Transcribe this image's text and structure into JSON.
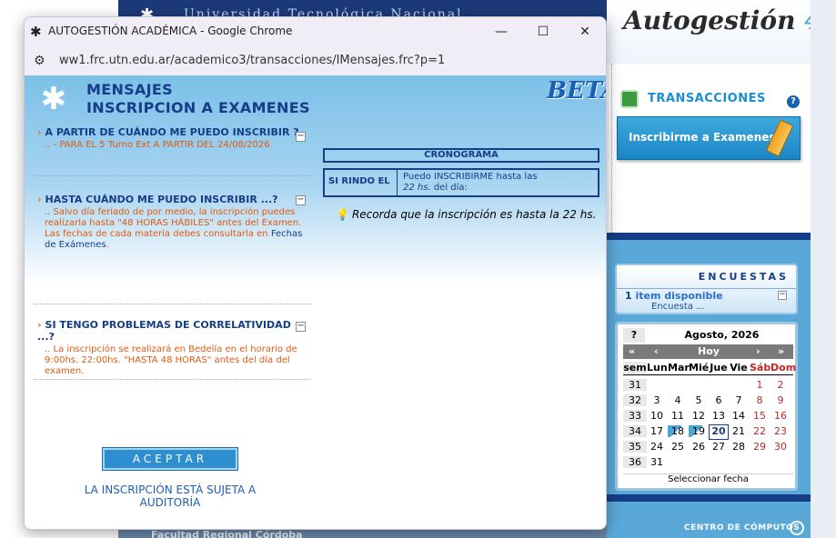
{
  "background": {
    "university_title": "Universidad Tecnológica Nacional",
    "brand": {
      "name": "Autogestión",
      "version": "4"
    },
    "transacciones": {
      "title": "TRANSACCIONES",
      "help": "?",
      "inscribir_button": "Inscribirme a Examenes"
    },
    "encuestas": {
      "title": "ENCUESTAS",
      "count": "1",
      "available_label": "item disponible",
      "item": "Encuesta ..."
    },
    "calendar": {
      "help": "?",
      "month_label": "Agosto, 2026",
      "nav": {
        "prev_year": "«",
        "prev_month": "‹",
        "today": "Hoy",
        "next_month": "›",
        "next_year": "»"
      },
      "dow": [
        "sem",
        "Lun",
        "Mar",
        "Mié",
        "Jue",
        "Vie",
        "Sáb",
        "Dom"
      ],
      "weeks": [
        {
          "wk": "31",
          "days": [
            "",
            "",
            "",
            "",
            "",
            "1",
            "2"
          ]
        },
        {
          "wk": "32",
          "days": [
            "3",
            "4",
            "5",
            "6",
            "7",
            "8",
            "9"
          ]
        },
        {
          "wk": "33",
          "days": [
            "10",
            "11",
            "12",
            "13",
            "14",
            "15",
            "16"
          ]
        },
        {
          "wk": "34",
          "days": [
            "17",
            "18",
            "19",
            "20",
            "21",
            "22",
            "23"
          ]
        },
        {
          "wk": "35",
          "days": [
            "24",
            "25",
            "26",
            "27",
            "28",
            "29",
            "30"
          ]
        },
        {
          "wk": "36",
          "days": [
            "31",
            "",
            "",
            "",
            "",
            "",
            ""
          ]
        }
      ],
      "today": "20",
      "footer": "Seleccionar fecha"
    },
    "footer_left": "Facultad Regional Córdoba",
    "footer_right": "CENTRO DE CÓMPUTOS"
  },
  "window": {
    "title": "AUTOGESTIÓN ACADÉMICA - Google Chrome",
    "url": "ww1.frc.utn.edu.ar/academico3/transacciones/IMensajes.frc?p=1",
    "controls": {
      "minimize": "—",
      "maximize": "☐",
      "close": "✕"
    }
  },
  "page": {
    "heading_line1": "MENSAJES",
    "heading_line2": "INSCRIPCION A EXAMENES",
    "beta": "BETA",
    "sections": [
      {
        "title": "A PARTIR DE CUÁNDO ME PUEDO INSCRIBIR ?",
        "body": ".. - PARA EL 5 Turno Ext A PARTIR DEL 24/08/2026",
        "toggle": "−"
      },
      {
        "title": "HASTA CUÁNDO ME PUEDO INSCRIBIR ...?",
        "body": ".. Salvo día feriado de por medio, la inscripción puedes realizarla hasta \"48 HORAS HÁBILES\" antes del Examen.",
        "body2": "Las fechas de cada materia debes consultarla en",
        "link": "Fechas de Exámenes",
        "toggle": "−"
      },
      {
        "title": "SI TENGO PROBLEMAS DE CORRELATIVIDAD ...?",
        "body": ".. La inscripción se realizará en Bedelía en el horario de 9:00hs. 22:00hs. \"HASTA 48 HORAS\" antes del día del examen.",
        "toggle": "−"
      }
    ],
    "cronograma": {
      "title": "CRONOGRAMA",
      "col1": "SI RINDO EL",
      "col2_line1": "Puedo INSCRIBIRME hasta las",
      "col2_line2_em": "22 hs.",
      "col2_line2_rest": " del día:"
    },
    "recorda": "Recorda que la inscripción es hasta la 22 hs.",
    "accept_button": "ACEPTAR",
    "audit_note": "LA INSCRIPCIÓN ESTÁ SUJETA A AUDITORÍA"
  }
}
